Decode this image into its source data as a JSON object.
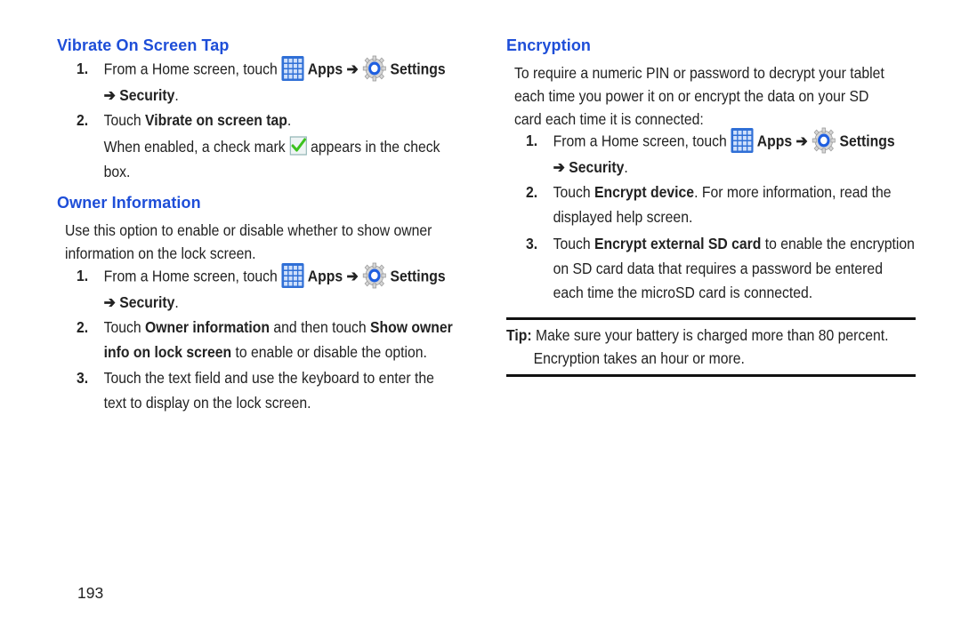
{
  "page_number": "193",
  "common": {
    "arrow": "➔",
    "apps_label": "Apps",
    "settings_label": "Settings",
    "security_label": "Security",
    "from_home": "From a Home screen, touch",
    "period": ".",
    "touch": "Touch"
  },
  "left": {
    "vibrate": {
      "heading": "Vibrate On Screen Tap",
      "steps": [
        {
          "num": "1."
        },
        {
          "num": "2.",
          "bold": "Vibrate on screen tap",
          "after": "."
        }
      ],
      "note_before": "When enabled, a check mark",
      "note_after": "appears in the check",
      "note_line2": "box."
    },
    "owner": {
      "heading": "Owner Information",
      "intro_line1": "Use this option to enable or disable whether to show owner",
      "intro_line2": "information on the lock screen.",
      "steps": [
        {
          "num": "1."
        },
        {
          "num": "2.",
          "bold1": "Owner information",
          "mid": "and then touch",
          "bold2": "Show owner",
          "bold3": "info on lock screen",
          "after": "to enable or disable the option."
        },
        {
          "num": "3.",
          "line1": "Touch the text field and use the keyboard to enter the",
          "line2": "text to display on the lock screen."
        }
      ]
    }
  },
  "right": {
    "encryption": {
      "heading": "Encryption",
      "intro_line1": "To require a numeric PIN or password to decrypt your tablet",
      "intro_line2": "each time you power it on or encrypt the data on your SD",
      "intro_line3": "card each time it is connected:",
      "steps": [
        {
          "num": "1."
        },
        {
          "num": "2.",
          "bold": "Encrypt device",
          "after": ". For more information, read the",
          "line2": "displayed help screen."
        },
        {
          "num": "3.",
          "bold": "Encrypt external SD card",
          "after": "to enable the encryption",
          "line2": "on SD card data that requires a password be entered",
          "line3": "each time the microSD card is connected."
        }
      ]
    },
    "tip": {
      "label": "Tip:",
      "line1": "Make sure your battery is charged more than 80 percent.",
      "line2": "Encryption takes an hour or more."
    }
  },
  "colors": {
    "heading": "#1e4ed8",
    "apps_icon": "#2f6fd6",
    "gear_ring": "#1f5fe0",
    "check": "#3cc21e"
  }
}
